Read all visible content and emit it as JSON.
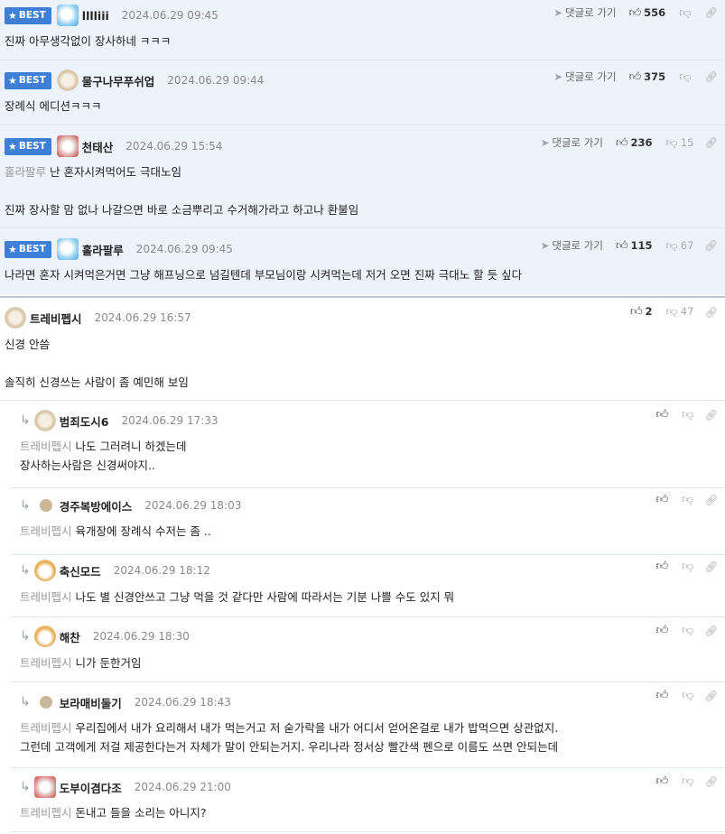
{
  "labels": {
    "best": "BEST",
    "goto_reply": "댓글로 가기"
  },
  "colors": {
    "best_bg": "#edf3fb",
    "badge": "#3e7fd7"
  },
  "best_comments": [
    {
      "nick": "lllliii",
      "date": "2024.06.29 09:45",
      "up": "556",
      "down": "",
      "lines": [
        "진짜 아무생각없이 장사하네 ㅋㅋㅋ"
      ]
    },
    {
      "nick": "물구나무푸쉬업",
      "date": "2024.06.29 09:44",
      "up": "375",
      "down": "",
      "lines": [
        "장례식 에디션ㅋㅋㅋ"
      ]
    },
    {
      "nick": "천태산",
      "date": "2024.06.29 15:54",
      "up": "236",
      "down": "15",
      "mention": "홀라팔루",
      "lines": [
        "난 혼자시켜먹어도 극대노임",
        "진짜 장사할 맘 없나 나갈으면 바로 소금뿌리고 수거해가라고 하고나 환불임"
      ]
    },
    {
      "nick": "홀라팔루",
      "date": "2024.06.29 09:45",
      "up": "115",
      "down": "67",
      "lines": [
        "나라면 혼자 시켜먹은거면 그냥 해프닝으로 넘길텐데 부모님이랑 시켜먹는데 저거 오면 진짜 극대노 할 듯 싶다"
      ]
    }
  ],
  "comment": {
    "nick": "트레비펩시",
    "date": "2024.06.29 16:57",
    "up": "2",
    "down": "47",
    "lines": [
      "신경 안씀",
      "솔직히 신경쓰는 사람이 좀 예민해 보임"
    ]
  },
  "replies": [
    {
      "nick": "범죄도시6",
      "date": "2024.06.29 17:33",
      "mention": "트레비펩시",
      "lines": [
        "나도 그러려니 하겠는데",
        "장사하는사람은 신경써야지.."
      ]
    },
    {
      "nick": "경주복방에이스",
      "date": "2024.06.29 18:03",
      "mention": "트레비펩시",
      "lines": [
        "육개장에 장례식 수저는 좀 .."
      ]
    },
    {
      "nick": "축신모드",
      "date": "2024.06.29 18:12",
      "mention": "트레비펩시",
      "lines": [
        "나도 별 신경안쓰고 그냥 먹을 것 같다만 사람에 따라서는 기분 나쁠 수도 있지 뭐"
      ]
    },
    {
      "nick": "해찬",
      "date": "2024.06.29 18:30",
      "mention": "트레비펩시",
      "lines": [
        "니가 둔한거임"
      ]
    },
    {
      "nick": "보라매비둘기",
      "date": "2024.06.29 18:43",
      "mention": "트레비펩시",
      "lines": [
        "우리집에서 내가 요리해서 내가 먹는거고 저 숟가락을 내가 어디서 얻어온걸로 내가 밥먹으면 상관없지.",
        "그런데 고객에게 저걸 제공한다는거 자체가 말이 안되는거지. 우리나라 정서상 빨간색 펜으로 이름도 쓰면 안되는데"
      ]
    },
    {
      "nick": "도부이겸다조",
      "date": "2024.06.29 21:00",
      "mention": "트레비펩시",
      "lines": [
        "돈내고 들을 소리는 아니지?"
      ]
    }
  ]
}
